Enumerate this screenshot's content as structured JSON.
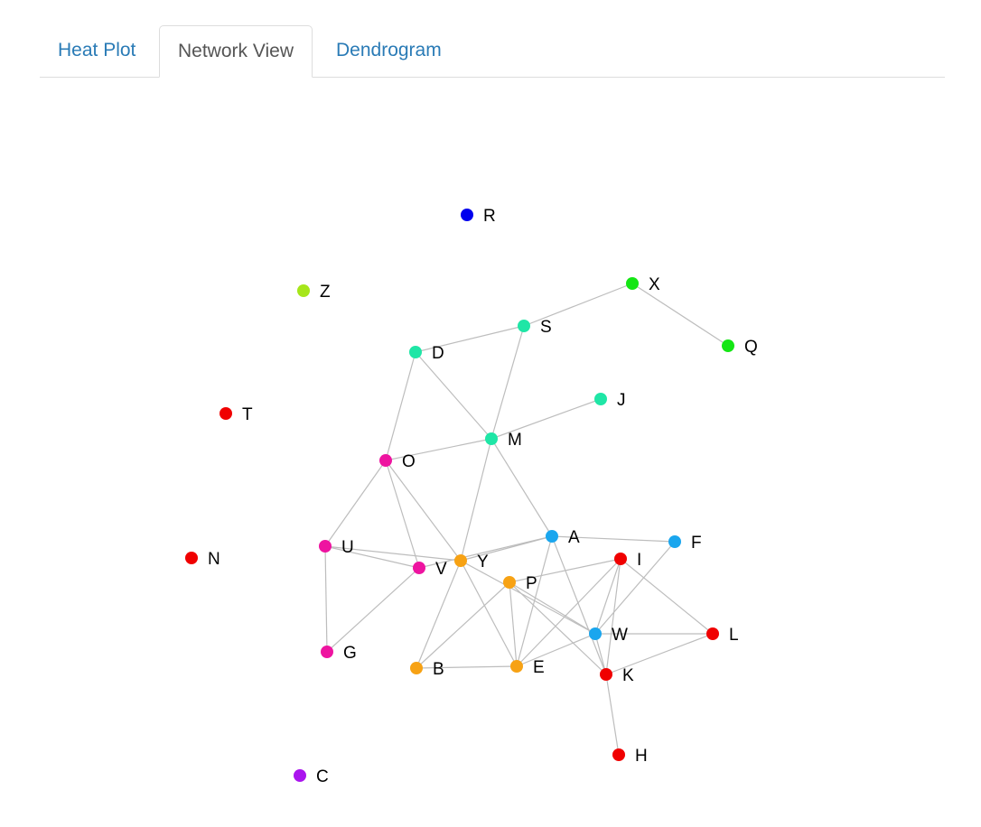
{
  "tabs": [
    {
      "label": "Heat Plot",
      "active": false
    },
    {
      "label": "Network View",
      "active": true
    },
    {
      "label": "Dendrogram",
      "active": false
    }
  ],
  "network": {
    "nodes": [
      {
        "id": "R",
        "color": "#0000ee"
      },
      {
        "id": "Z",
        "color": "#a6e61a"
      },
      {
        "id": "X",
        "color": "#14e614"
      },
      {
        "id": "Q",
        "color": "#14e614"
      },
      {
        "id": "S",
        "color": "#1fe6a6"
      },
      {
        "id": "D",
        "color": "#1fe6a6"
      },
      {
        "id": "J",
        "color": "#1fe6a6"
      },
      {
        "id": "M",
        "color": "#1fe6a6"
      },
      {
        "id": "T",
        "color": "#f00000"
      },
      {
        "id": "O",
        "color": "#ee14a0"
      },
      {
        "id": "N",
        "color": "#f00000"
      },
      {
        "id": "U",
        "color": "#ee14a0"
      },
      {
        "id": "V",
        "color": "#ee14a0"
      },
      {
        "id": "G",
        "color": "#ee14a0"
      },
      {
        "id": "Y",
        "color": "#f7a214"
      },
      {
        "id": "P",
        "color": "#f7a214"
      },
      {
        "id": "B",
        "color": "#f7a214"
      },
      {
        "id": "E",
        "color": "#f7a214"
      },
      {
        "id": "A",
        "color": "#1aa6ee"
      },
      {
        "id": "F",
        "color": "#1aa6ee"
      },
      {
        "id": "W",
        "color": "#1aa6ee"
      },
      {
        "id": "I",
        "color": "#f00000"
      },
      {
        "id": "L",
        "color": "#f00000"
      },
      {
        "id": "K",
        "color": "#f00000"
      },
      {
        "id": "H",
        "color": "#f00000"
      },
      {
        "id": "C",
        "color": "#aa14ee"
      }
    ],
    "edges": [
      [
        "X",
        "S"
      ],
      [
        "X",
        "Q"
      ],
      [
        "S",
        "D"
      ],
      [
        "S",
        "M"
      ],
      [
        "D",
        "M"
      ],
      [
        "D",
        "O"
      ],
      [
        "J",
        "M"
      ],
      [
        "M",
        "O"
      ],
      [
        "M",
        "Y"
      ],
      [
        "M",
        "A"
      ],
      [
        "O",
        "U"
      ],
      [
        "O",
        "V"
      ],
      [
        "O",
        "Y"
      ],
      [
        "U",
        "V"
      ],
      [
        "U",
        "Y"
      ],
      [
        "U",
        "G"
      ],
      [
        "V",
        "G"
      ],
      [
        "V",
        "A"
      ],
      [
        "Y",
        "A"
      ],
      [
        "Y",
        "B"
      ],
      [
        "Y",
        "E"
      ],
      [
        "Y",
        "W"
      ],
      [
        "A",
        "F"
      ],
      [
        "A",
        "E"
      ],
      [
        "A",
        "K"
      ],
      [
        "P",
        "B"
      ],
      [
        "P",
        "E"
      ],
      [
        "P",
        "I"
      ],
      [
        "P",
        "W"
      ],
      [
        "P",
        "K"
      ],
      [
        "B",
        "E"
      ],
      [
        "E",
        "I"
      ],
      [
        "E",
        "W"
      ],
      [
        "F",
        "W"
      ],
      [
        "I",
        "W"
      ],
      [
        "I",
        "K"
      ],
      [
        "I",
        "L"
      ],
      [
        "W",
        "L"
      ],
      [
        "W",
        "K"
      ],
      [
        "K",
        "L"
      ],
      [
        "K",
        "H"
      ]
    ]
  }
}
